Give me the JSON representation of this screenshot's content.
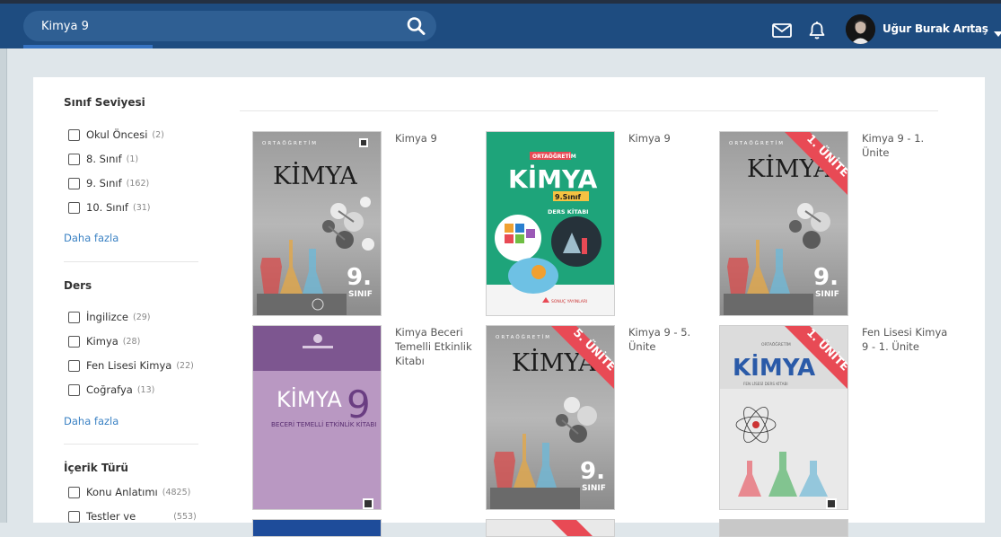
{
  "header": {
    "search_value": "Kimya 9",
    "user_name": "Uğur Burak Arıtaş"
  },
  "sidebar": {
    "facets": [
      {
        "title": "Sınıf Seviyesi",
        "items": [
          {
            "label": "Okul Öncesi",
            "count": "(2)"
          },
          {
            "label": "8. Sınıf",
            "count": "(1)"
          },
          {
            "label": "9. Sınıf",
            "count": "(162)"
          },
          {
            "label": "10. Sınıf",
            "count": "(31)"
          }
        ],
        "more": "Daha fazla"
      },
      {
        "title": "Ders",
        "items": [
          {
            "label": "İngilizce",
            "count": "(29)"
          },
          {
            "label": "Kimya",
            "count": "(28)"
          },
          {
            "label": "Fen Lisesi Kimya",
            "count": "(22)"
          },
          {
            "label": "Coğrafya",
            "count": "(13)"
          }
        ],
        "more": "Daha fazla"
      },
      {
        "title": "İçerik Türü",
        "items": [
          {
            "label": "Konu Anlatımı",
            "count": "(4825)"
          },
          {
            "label": "Testler ve",
            "count": "(553)"
          }
        ]
      }
    ]
  },
  "books": [
    {
      "title": "Kimya 9",
      "cover": {
        "top": "ORTAÖĞRETİM",
        "main": "KİMYA",
        "grade": "9.",
        "sub": "SINIF",
        "ribbon": ""
      }
    },
    {
      "title": "Kimya 9",
      "cover": {
        "top": "ORTAÖĞRETİM",
        "main": "KİMYA",
        "grade": "9.Sınıf",
        "sub": "DERS KİTABI",
        "ribbon": "",
        "publisher": "SONUÇ YAYINLARI"
      }
    },
    {
      "title": "Kimya 9 - 1. Ünite",
      "cover": {
        "top": "ORTAÖĞRETİM",
        "main": "KİMYA",
        "grade": "9.",
        "sub": "SINIF",
        "ribbon": "1. ÜNİTE"
      }
    },
    {
      "title": "Kimya Beceri Temelli Etkinlik Kitabı",
      "cover": {
        "main": "KİMYA",
        "grade": "9",
        "sub": "BECERİ TEMELLİ ETKİNLİK KİTABI"
      }
    },
    {
      "title": "Kimya 9 - 5. Ünite",
      "cover": {
        "top": "ORTAÖĞRETİM",
        "main": "KİMYA",
        "grade": "9.",
        "sub": "SINIF",
        "ribbon": "5. ÜNİTE"
      }
    },
    {
      "title": "Fen Lisesi Kimya 9 - 1. Ünite",
      "cover": {
        "top": "ORTAÖĞRETİM",
        "main": "KİMYA",
        "sub": "FEN LİSESİ DERS KİTABI",
        "ribbon": "1. ÜNİTE"
      }
    }
  ],
  "colors": {
    "topbar": "#1e4c80",
    "search_bg": "#2f5f93",
    "link": "#3b82c4",
    "ribbon": "#e84a55",
    "cover_green": "#1ea47a",
    "cover_purple": "#9a72a8"
  }
}
